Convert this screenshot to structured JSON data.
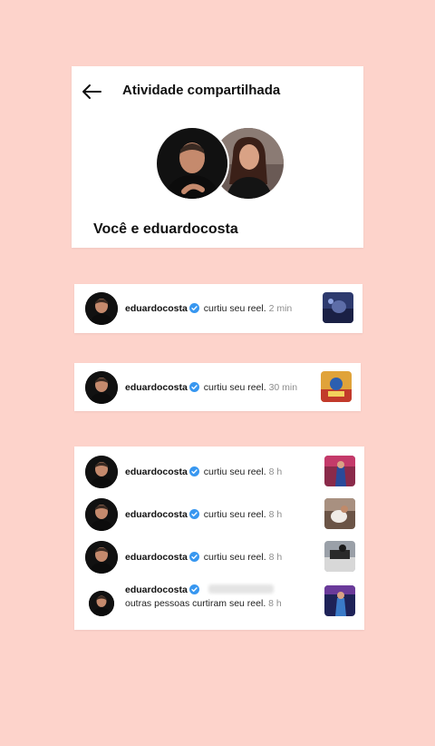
{
  "header": {
    "title": "Atividade compartilhada",
    "subtitle": "Você e eduardocosta"
  },
  "notifications": [
    {
      "username": "eduardocosta",
      "action": "curtiu seu reel.",
      "time": "2 min"
    },
    {
      "username": "eduardocosta",
      "action": "curtiu seu reel.",
      "time": "30 min"
    },
    {
      "username": "eduardocosta",
      "action": "curtiu seu reel.",
      "time": "8 h"
    },
    {
      "username": "eduardocosta",
      "action": "curtiu seu reel.",
      "time": "8 h"
    },
    {
      "username": "eduardocosta",
      "action": "curtiu seu reel.",
      "time": "8 h"
    },
    {
      "username": "eduardocosta",
      "action": "outras pessoas curtiram seu reel.",
      "time": "8 h"
    }
  ],
  "colors": {
    "background": "#fdd3cb",
    "verified": "#3897f0",
    "time": "#8e8e8e"
  },
  "icons": {
    "back": "arrow-left-icon",
    "verified": "verified-badge-icon"
  }
}
